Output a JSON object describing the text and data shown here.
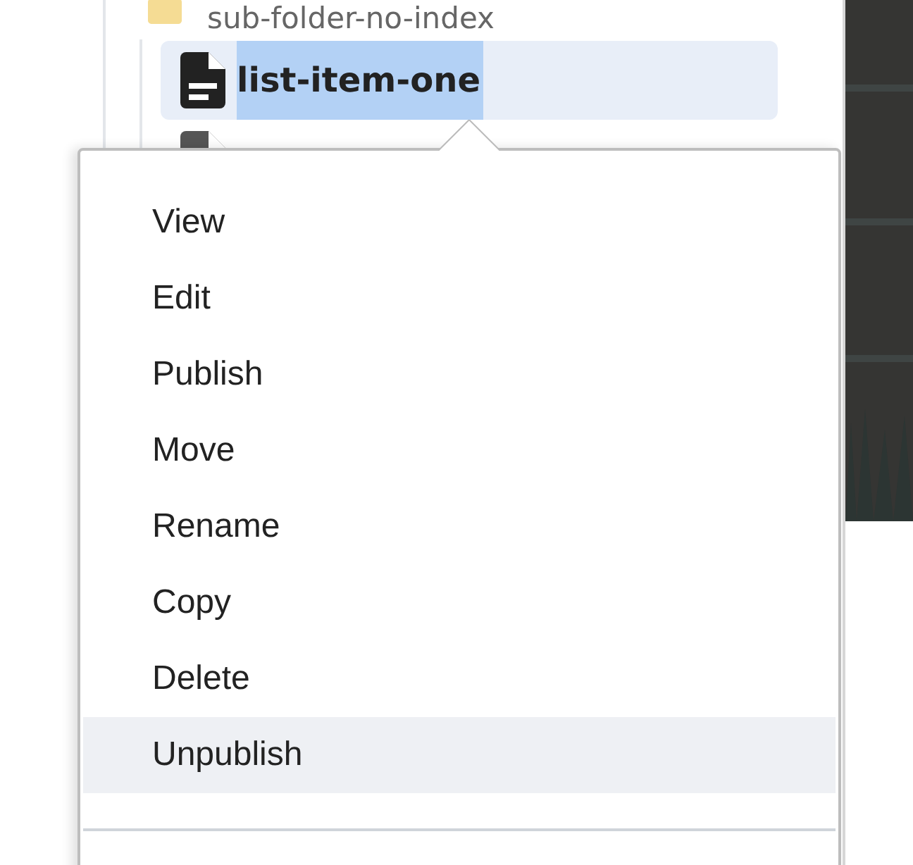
{
  "tree": {
    "folder": "sub-folder-no-index",
    "items": [
      {
        "name": "list-item-one",
        "selected": true
      }
    ]
  },
  "context_menu": {
    "items": [
      {
        "label": "View",
        "selected": false
      },
      {
        "label": "Edit",
        "selected": false
      },
      {
        "label": "Publish",
        "selected": false
      },
      {
        "label": "Move",
        "selected": false
      },
      {
        "label": "Rename",
        "selected": false
      },
      {
        "label": "Copy",
        "selected": false
      },
      {
        "label": "Delete",
        "selected": false
      },
      {
        "label": "Unpublish",
        "selected": true
      }
    ]
  }
}
